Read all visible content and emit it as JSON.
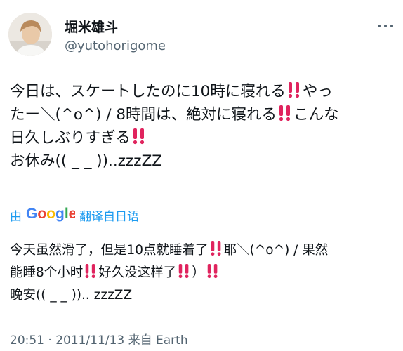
{
  "author": {
    "display_name": "堀米雄斗",
    "handle": "@yutohorigome"
  },
  "tweet": {
    "lines": [
      "今日は、スケートしたのに10時に寝れる",
      "やっ",
      "たー＼(^o^) / 8時間は、絶対に寝れる",
      "こんな",
      "日久しぶりすぎる",
      "お休み(( _ _ ))..zzzZZ"
    ]
  },
  "translation": {
    "by_label": "由",
    "engine": "Google",
    "from_label": "翻译自日语",
    "lines": [
      "今天虽然滑了，但是10点就睡着了",
      "耶＼(^o^) / 果然",
      "能睡8个小时",
      "好久没这样了",
      "）",
      "晚安(( _ _ )).. zzzZZ"
    ]
  },
  "meta": {
    "time": "20:51",
    "separator": "·",
    "date": "2011/11/13",
    "via_label": "来自",
    "source": "Earth"
  },
  "icons": {
    "more": "more-options-icon",
    "emphasis": "double-exclamation-icon"
  },
  "colors": {
    "accent": "#1d9bf0",
    "text": "#0f1419",
    "secondary": "#536471",
    "emphasis": "#e0245e"
  }
}
